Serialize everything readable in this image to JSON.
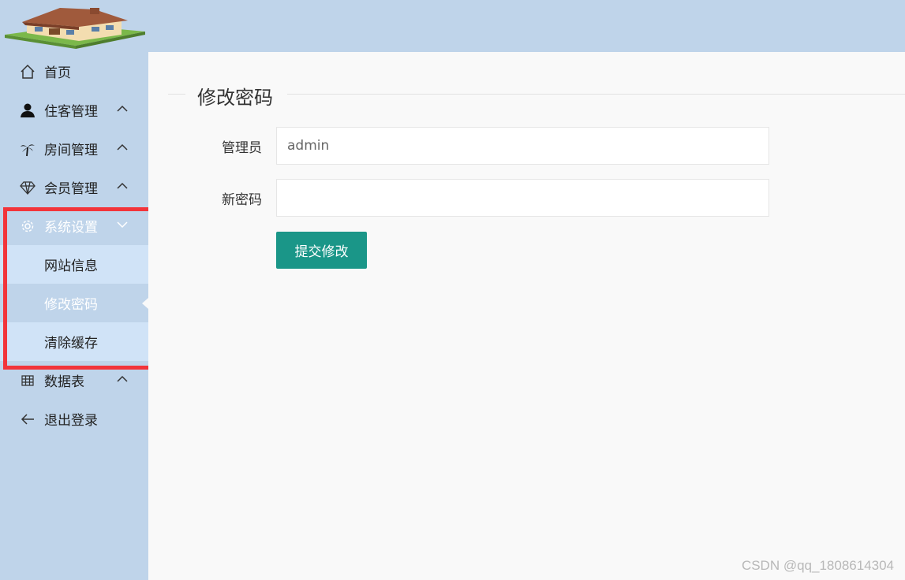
{
  "sidebar": {
    "items": [
      {
        "label": "首页",
        "icon": "home-icon"
      },
      {
        "label": "住客管理",
        "icon": "user-icon"
      },
      {
        "label": "房间管理",
        "icon": "palm-tree-icon"
      },
      {
        "label": "会员管理",
        "icon": "diamond-icon"
      },
      {
        "label": "系统设置",
        "icon": "gear-icon"
      },
      {
        "label": "数据表",
        "icon": "table-icon"
      },
      {
        "label": "退出登录",
        "icon": "arrow-left-icon"
      }
    ],
    "submenu": [
      "网站信息",
      "修改密码",
      "清除缓存"
    ]
  },
  "form": {
    "title": "修改密码",
    "admin_label": "管理员",
    "admin_value": "admin",
    "password_label": "新密码",
    "password_value": "",
    "submit_label": "提交修改"
  },
  "watermark": "CSDN @qq_1808614304",
  "colors": {
    "header_bg": "#bfd4ea",
    "submenu_bg": "#d0e3f7",
    "button": "#1a9688",
    "highlight": "#f2343a"
  }
}
